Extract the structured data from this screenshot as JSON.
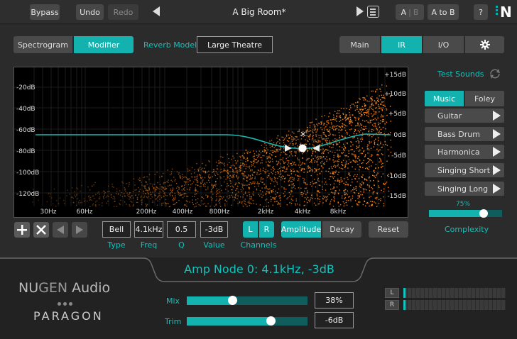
{
  "topbar": {
    "bypass": "Bypass",
    "undo": "Undo",
    "redo": "Redo",
    "preset": "A Big Room*",
    "ab_a": "A",
    "ab_b": "B",
    "atob": "A to B",
    "help": "?",
    "logo": "N"
  },
  "view_tabs": [
    "Spectrogram",
    "Modifier"
  ],
  "active_view": "Modifier",
  "reverb_model": {
    "label": "Reverb Model:",
    "value": "Large Theatre"
  },
  "main_tabs": [
    "Main",
    "IR",
    "I/O"
  ],
  "active_main_tab": "IR",
  "spectrum": {
    "db_left": [
      "-20dB",
      "-40dB",
      "-60dB",
      "-80dB",
      "-100dB",
      "-120dB"
    ],
    "db_right": [
      "+15dB",
      "+10dB",
      "+5dB",
      "0dB",
      "-5dB",
      "-10dB",
      "-15dB"
    ],
    "freq": [
      "30Hz",
      "60Hz",
      "200Hz",
      "400Hz",
      "800Hz",
      "2kHz",
      "4kHz",
      "8kHz"
    ]
  },
  "node_controls": {
    "type": {
      "label": "Type",
      "value": "Bell"
    },
    "freq": {
      "label": "Freq",
      "value": "4.1kHz"
    },
    "q": {
      "label": "Q",
      "value": "0.5"
    },
    "value": {
      "label": "Value",
      "value": "-3dB"
    },
    "channels": {
      "label": "Channels",
      "l": "L",
      "r": "R"
    },
    "amplitude": "Amplitude",
    "decay": "Decay",
    "reset": "Reset"
  },
  "test_sounds": {
    "title": "Test Sounds",
    "tabs": [
      "Music",
      "Foley"
    ],
    "active_tab": "Music",
    "items": [
      "Guitar",
      "Bass Drum",
      "Harmonica",
      "Singing Short",
      "Singing Long"
    ]
  },
  "complexity": {
    "label": "Complexity",
    "value_text": "75%",
    "value": 0.75
  },
  "status": "Amp Node 0: 4.1kHz, -3dB",
  "brand": {
    "nu": "NU",
    "gen": "GEN",
    "audio": " Audio",
    "product": "PARAGON"
  },
  "mix": {
    "label": "Mix",
    "value_text": "38%",
    "value": 0.38
  },
  "trim": {
    "label": "Trim",
    "value_text": "-6dB"
  },
  "meters": {
    "l": "L",
    "r": "R"
  },
  "colors": {
    "accent": "#14b2ae",
    "spectrum": "#ff8a1e",
    "curve": "#1fb5ae"
  }
}
